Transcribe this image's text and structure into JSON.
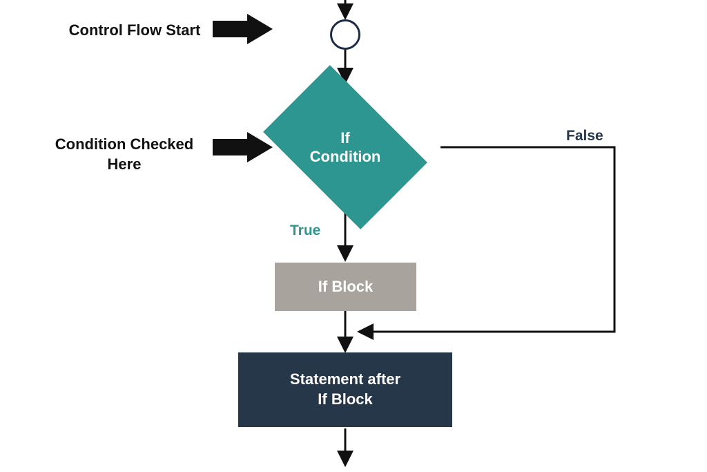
{
  "annotations": {
    "control_flow_start": "Control Flow Start",
    "condition_checked": "Condition Checked\nHere"
  },
  "nodes": {
    "start": "",
    "condition": "If\nCondition",
    "if_block": "If Block",
    "after_block": "Statement after\nIf Block"
  },
  "edges": {
    "true_label": "True",
    "false_label": "False"
  },
  "colors": {
    "teal": "#2d9690",
    "gray": "#a8a39d",
    "dark": "#27374a",
    "ink": "#111111"
  }
}
